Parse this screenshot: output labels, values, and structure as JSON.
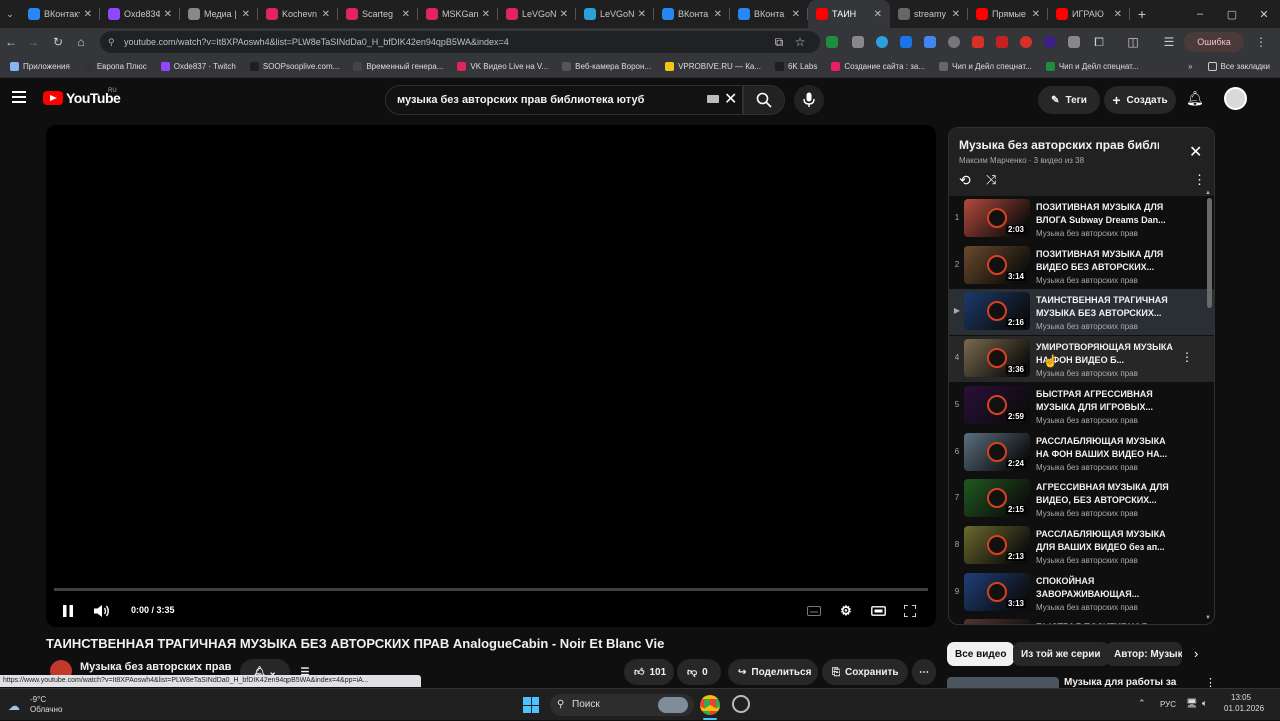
{
  "browser": {
    "tabs": [
      {
        "title": "ВКонтакте",
        "favicon_color": "#2787f5",
        "favicon_glyph": "vk-icon"
      },
      {
        "title": "Oxde83Ф",
        "favicon_color": "#9146ff",
        "favicon_glyph": "twitch-icon"
      },
      {
        "title": "Медиа |",
        "favicon_color": "#888888",
        "favicon_glyph": "media-icon"
      },
      {
        "title": "Kochevn",
        "favicon_color": "#e0245e",
        "favicon_glyph": "vkvideo-icon"
      },
      {
        "title": "Scarteg",
        "favicon_color": "#e0245e",
        "favicon_glyph": "vkvideo-icon"
      },
      {
        "title": "MSKGan",
        "favicon_color": "#e0245e",
        "favicon_glyph": "vkvideo-icon"
      },
      {
        "title": "LeVGoN",
        "favicon_color": "#e0245e",
        "favicon_glyph": "vkvideo-icon"
      },
      {
        "title": "LeVGoN",
        "favicon_color": "#2aa1da",
        "favicon_glyph": "telegram-icon"
      },
      {
        "title": "ВКонта",
        "favicon_color": "#2787f5",
        "favicon_glyph": "vk-icon"
      },
      {
        "title": "ВКонта",
        "favicon_color": "#2787f5",
        "favicon_glyph": "vk-icon"
      },
      {
        "title": "ТАИН",
        "favicon_color": "#ff0000",
        "favicon_glyph": "youtube-icon",
        "active": true
      },
      {
        "title": "streamy",
        "favicon_color": "#666666",
        "favicon_glyph": "globe-icon"
      },
      {
        "title": "Прямые",
        "favicon_color": "#ff0000",
        "favicon_glyph": "youtube-icon"
      },
      {
        "title": "ИГРАЮ",
        "favicon_color": "#ff0000",
        "favicon_glyph": "youtube-icon"
      }
    ],
    "url": "youtube.com/watch?v=It8XPAoswh4&list=PLW8eTaSINdDa0_H_bfDIK42en94qpB5WA&index=4",
    "error_button": "Ошибка",
    "bookmarks": [
      {
        "label": "Приложения",
        "color": "#8ab4f8"
      },
      {
        "label": "Европа Плюс",
        "color": "#333333"
      },
      {
        "label": "Oxde837 · Twitch",
        "color": "#9146ff"
      },
      {
        "label": "SOOPsooplive.com...",
        "color": "#1f1f1f"
      },
      {
        "label": "Временный генера...",
        "color": "#444444"
      },
      {
        "label": "VK Видео Live на V...",
        "color": "#e0245e"
      },
      {
        "label": "Веб-камера Ворон...",
        "color": "#555555"
      },
      {
        "label": "VPROBIVE.RU — Ка...",
        "color": "#f5c518"
      },
      {
        "label": "6K Labs",
        "color": "#1f1f1f"
      },
      {
        "label": "Создание сайта : за...",
        "color": "#e91e63"
      },
      {
        "label": "Чип и Дейл спецнат...",
        "color": "#666666"
      },
      {
        "label": "Чип и Дейл спецнат...",
        "color": "#1e8e3e"
      }
    ],
    "all_bookmarks": "Все закладки",
    "status_url": "https://www.youtube.com/watch?v=It8XPAoswh4&list=PLW8eTaSINdDa0_H_bfDIK42en94qpB5WA&index=4&pp=iA..."
  },
  "youtube": {
    "logo_text": "YouTube",
    "region": "RU",
    "search_query": "музыка без авторских прав библиотека ютуб",
    "tags_button": "Теги",
    "create_button": "Создать"
  },
  "player": {
    "time": "0:00 / 3:35",
    "progress": 0
  },
  "video": {
    "title": "ТАИНСТВЕННАЯ ТРАГИЧНАЯ МУЗЫКА БЕЗ АВТОРСКИХ ПРАВ AnalogueCabin - Noir Et Blanc Vie",
    "channel": "Музыка без авторских прав",
    "likes": "101",
    "dislikes": "0",
    "share": "Поделиться",
    "save": "Сохранить"
  },
  "playlist": {
    "title": "Музыка без авторских прав библи...",
    "subtitle": "Максим Марченко · 3 видео из 38",
    "items": [
      {
        "index": "1",
        "title": "ПОЗИТИВНАЯ МУЗЫКА ДЛЯ ВЛОГА Subway Dreams Dan...",
        "channel": "Музыка без авторских прав",
        "duration": "2:03",
        "thumb": "#b44a3c"
      },
      {
        "index": "2",
        "title": "ПОЗИТИВНАЯ МУЗЫКА ДЛЯ ВИДЕО БЕЗ АВТОРСКИХ...",
        "channel": "Музыка без авторских прав",
        "duration": "3:14",
        "thumb": "#6b4a2c"
      },
      {
        "index": "▶",
        "title": "ТАИНСТВЕННАЯ ТРАГИЧНАЯ МУЗЫКА БЕЗ АВТОРСКИХ...",
        "channel": "Музыка без авторских прав",
        "duration": "2:16",
        "thumb": "#1d3a6b",
        "current": true
      },
      {
        "index": "4",
        "title": "УМИРОТВОРЯЮЩАЯ МУЗЫКА НА ФОН ВИДЕО Б...",
        "channel": "Музыка без авторских прав",
        "duration": "3:36",
        "thumb": "#7a6a4f",
        "hover": true
      },
      {
        "index": "5",
        "title": "БЫСТРАЯ АГРЕССИВНАЯ МУЗЫКА ДЛЯ ИГРОВЫХ...",
        "channel": "Музыка без авторских прав",
        "duration": "2:59",
        "thumb": "#2a0f3a"
      },
      {
        "index": "6",
        "title": "РАССЛАБЛЯЮЩАЯ МУЗЫКА НА ФОН ВАШИХ ВИДЕО НА...",
        "channel": "Музыка без авторских прав",
        "duration": "2:24",
        "thumb": "#5b6f80"
      },
      {
        "index": "7",
        "title": "АГРЕССИВНАЯ МУЗЫКА ДЛЯ ВИДЕО, БЕЗ АВТОРСКИХ...",
        "channel": "Музыка без авторских прав",
        "duration": "2:15",
        "thumb": "#1f5a1f"
      },
      {
        "index": "8",
        "title": "РАССЛАБЛЯЮЩАЯ МУЗЫКА ДЛЯ ВАШИХ ВИДЕО без ап...",
        "channel": "Музыка без авторских прав",
        "duration": "2:13",
        "thumb": "#6b6a2c"
      },
      {
        "index": "9",
        "title": "СПОКОЙНАЯ ЗАВОРАЖИВАЮЩАЯ...",
        "channel": "Музыка без авторских прав",
        "duration": "3:13",
        "thumb": "#1f3f7a"
      },
      {
        "index": "",
        "title": "БЫСТРАЯ ПОЗИТИВНАЯ",
        "channel": "",
        "duration": "",
        "thumb": "#553333"
      }
    ]
  },
  "chips": [
    "Все видео",
    "Из той же серии",
    "Автор: Музык"
  ],
  "related_title": "Музыка для работы за",
  "taskbar": {
    "temp": "-9°C",
    "weather": "Облачно",
    "search": "Поиск",
    "lang": "РУС",
    "time": "13:05",
    "date": "01.01.2026"
  }
}
